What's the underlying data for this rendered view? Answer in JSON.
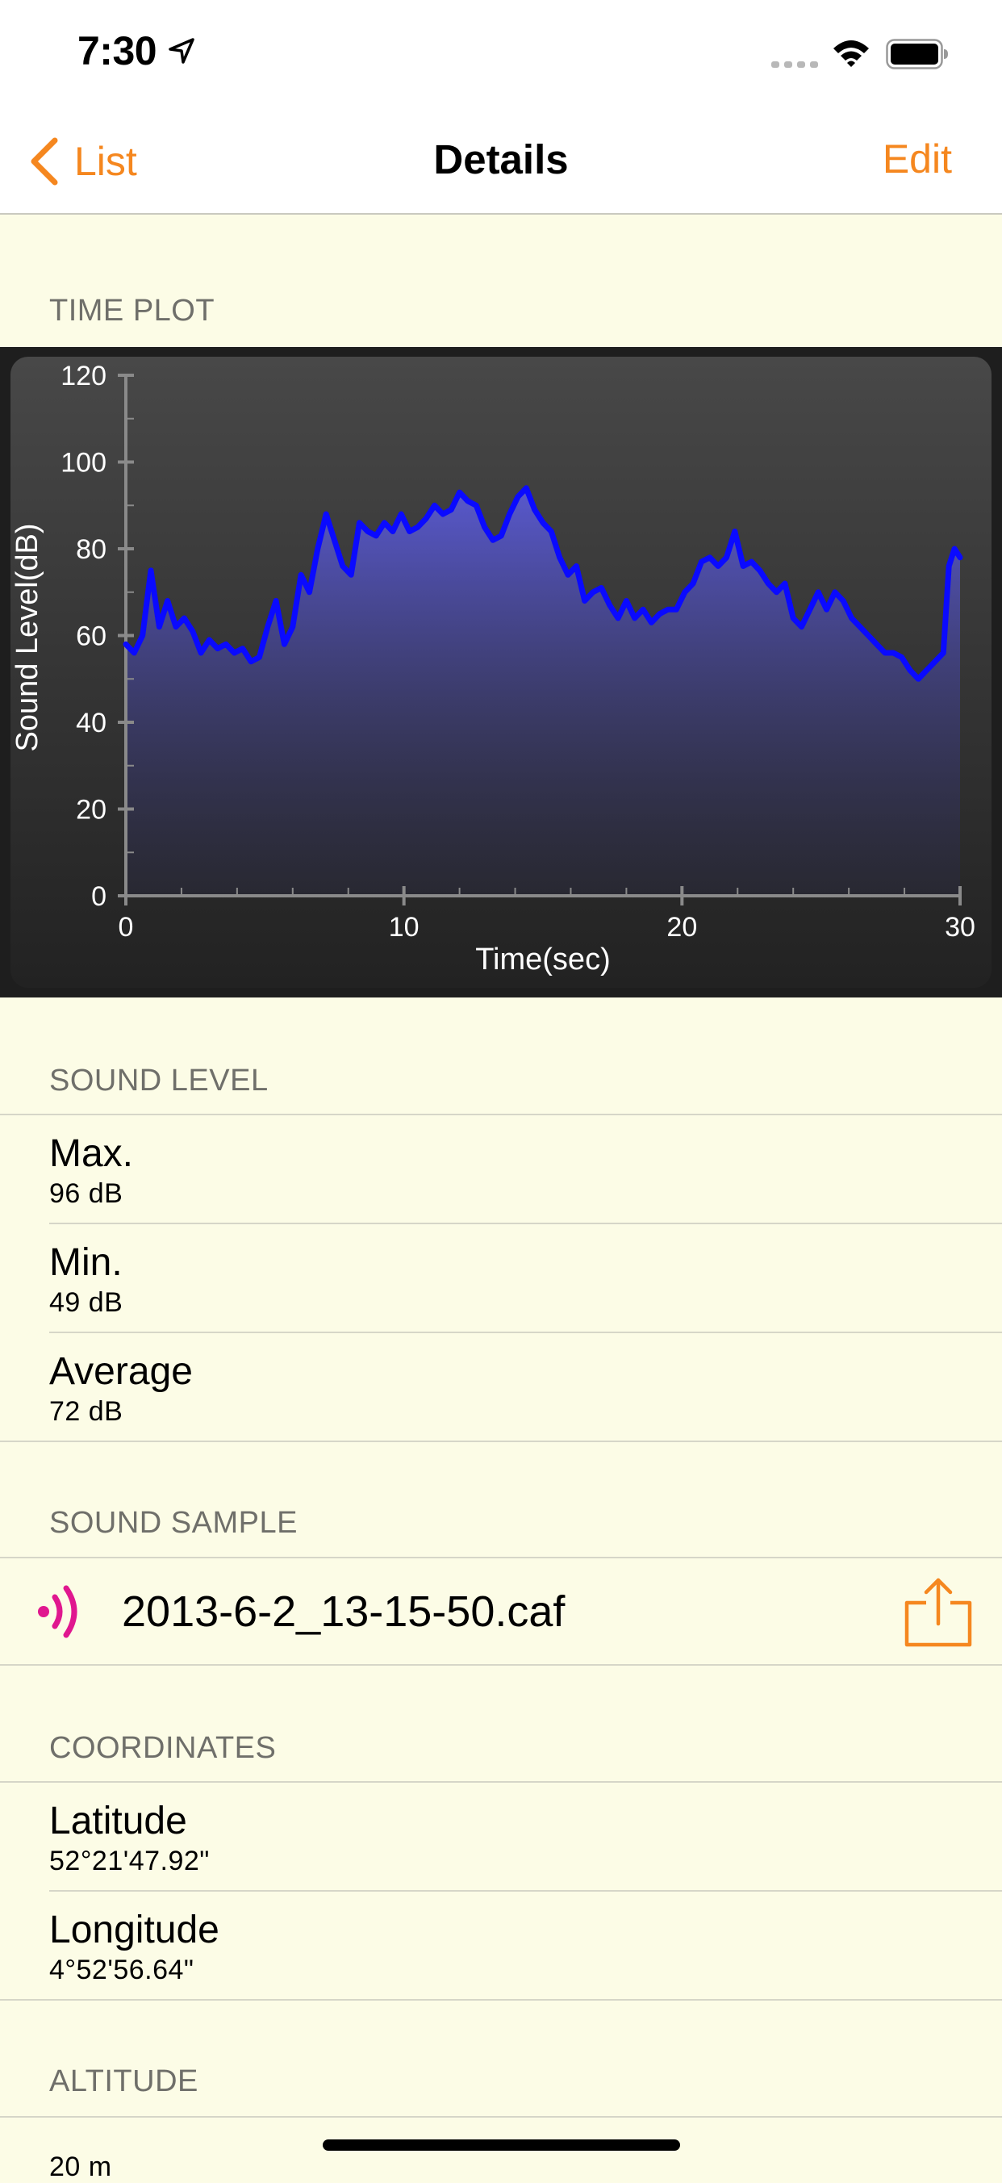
{
  "status_bar": {
    "time": "7:30"
  },
  "nav": {
    "back_label": "List",
    "title": "Details",
    "edit_label": "Edit"
  },
  "sections": {
    "time_plot": "TIME PLOT",
    "sound_level": "SOUND LEVEL",
    "sound_sample": "SOUND SAMPLE",
    "coordinates": "COORDINATES",
    "altitude": "ALTITUDE"
  },
  "sound_level": {
    "max": {
      "label": "Max.",
      "value": "96 dB"
    },
    "min": {
      "label": "Min.",
      "value": "49 dB"
    },
    "average": {
      "label": "Average",
      "value": "72 dB"
    }
  },
  "sound_sample": {
    "filename": "2013-6-2_13-15-50.caf"
  },
  "coordinates": {
    "latitude": {
      "label": "Latitude",
      "value": "52°21'47.92\""
    },
    "longitude": {
      "label": "Longitude",
      "value": "4°52'56.64\""
    }
  },
  "altitude": {
    "value": "20 m"
  },
  "colors": {
    "accent": "#f5871f",
    "line": "#0a0aff",
    "speaker": "#e0178f",
    "background": "#fcfce6"
  },
  "icons": {
    "back": "chevron-left-icon",
    "location": "location-arrow-icon",
    "sample": "speaker-icon",
    "share": "share-icon"
  },
  "chart_data": {
    "type": "area",
    "xlabel": "Time(sec)",
    "ylabel": "Sound Level(dB)",
    "xlim": [
      0,
      30
    ],
    "ylim": [
      0,
      120
    ],
    "x_ticks": [
      0,
      10,
      20,
      30
    ],
    "y_ticks": [
      0,
      20,
      40,
      60,
      80,
      100,
      120
    ],
    "grid": false,
    "series": [
      {
        "x": [
          0,
          0.3,
          0.6,
          0.9,
          1.2,
          1.5,
          1.8,
          2.1,
          2.4,
          2.7,
          3.0,
          3.3,
          3.6,
          3.9,
          4.2,
          4.5,
          4.8,
          5.1,
          5.4,
          5.7,
          6.0,
          6.3,
          6.6,
          6.9,
          7.2,
          7.5,
          7.8,
          8.1,
          8.4,
          8.7,
          9.0,
          9.3,
          9.6,
          9.9,
          10.2,
          10.5,
          10.8,
          11.1,
          11.4,
          11.7,
          12.0,
          12.3,
          12.6,
          12.9,
          13.2,
          13.5,
          13.8,
          14.1,
          14.4,
          14.7,
          15.0,
          15.3,
          15.6,
          15.9,
          16.2,
          16.5,
          16.8,
          17.1,
          17.4,
          17.7,
          18.0,
          18.3,
          18.6,
          18.9,
          19.2,
          19.5,
          19.8,
          20.1,
          20.4,
          20.7,
          21.0,
          21.3,
          21.6,
          21.9,
          22.2,
          22.5,
          22.8,
          23.1,
          23.4,
          23.7,
          24.0,
          24.3,
          24.6,
          24.9,
          25.2,
          25.5,
          25.8,
          26.1,
          26.4,
          26.7,
          27.0,
          27.3,
          27.6,
          27.9,
          28.2,
          28.5,
          28.8,
          29.1,
          29.4,
          29.6,
          29.8,
          30
        ],
        "values": [
          58,
          56,
          60,
          75,
          62,
          68,
          62,
          64,
          61,
          56,
          59,
          57,
          58,
          56,
          57,
          54,
          55,
          62,
          68,
          58,
          62,
          74,
          70,
          80,
          88,
          82,
          76,
          74,
          86,
          84,
          83,
          86,
          84,
          88,
          84,
          85,
          87,
          90,
          88,
          89,
          93,
          91,
          90,
          85,
          82,
          83,
          88,
          92,
          94,
          89,
          86,
          84,
          78,
          74,
          76,
          68,
          70,
          71,
          67,
          64,
          68,
          64,
          66,
          63,
          65,
          66,
          66,
          70,
          72,
          77,
          78,
          76,
          78,
          84,
          76,
          77,
          75,
          72,
          70,
          72,
          64,
          62,
          66,
          70,
          66,
          70,
          68,
          64,
          62,
          60,
          58,
          56,
          56,
          55,
          52,
          50,
          52,
          54,
          56,
          76,
          80,
          78
        ]
      }
    ]
  }
}
